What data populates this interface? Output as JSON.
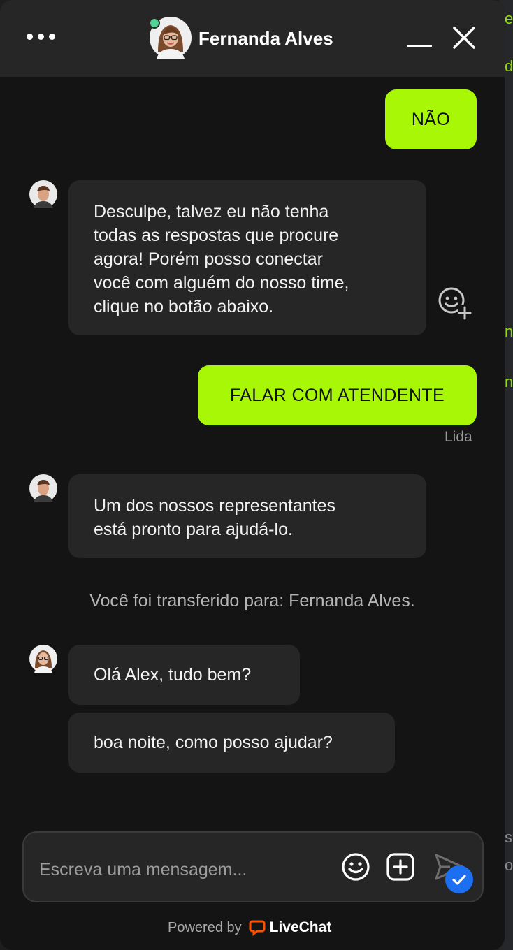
{
  "header": {
    "agent_name": "Fernanda Alves",
    "menu_icon": "more-dots-icon",
    "minimize_icon": "minimize-icon",
    "close_icon": "close-icon",
    "status_color": "#4ed492"
  },
  "messages": {
    "m1": "NÃO",
    "m2_lines": [
      "Desculpe, talvez eu não tenha",
      "todas as respostas que procure",
      "agora! Porém posso conectar",
      "você com alguém do nosso time,",
      "clique no botão abaixo."
    ],
    "m3": "FALAR COM ATENDENTE",
    "read_status": "Lida",
    "m4_lines": [
      "Um dos nossos representantes",
      "está pronto para ajudá-lo."
    ],
    "system": "Você foi transferido para: Fernanda Alves.",
    "m5": "Olá Alex, tudo bem?",
    "m6": "boa noite, como posso ajudar?"
  },
  "composer": {
    "placeholder": "Escreva uma mensagem...",
    "emoji_icon": "emoji-icon",
    "attach_icon": "add-attachment-icon",
    "send_icon": "send-icon"
  },
  "footer": {
    "powered_by": "Powered by",
    "brand": "LiveChat",
    "brand_color": "#ff5100"
  },
  "colors": {
    "accent": "#a7f707",
    "bubble_incoming": "#262626",
    "background": "#141414"
  }
}
